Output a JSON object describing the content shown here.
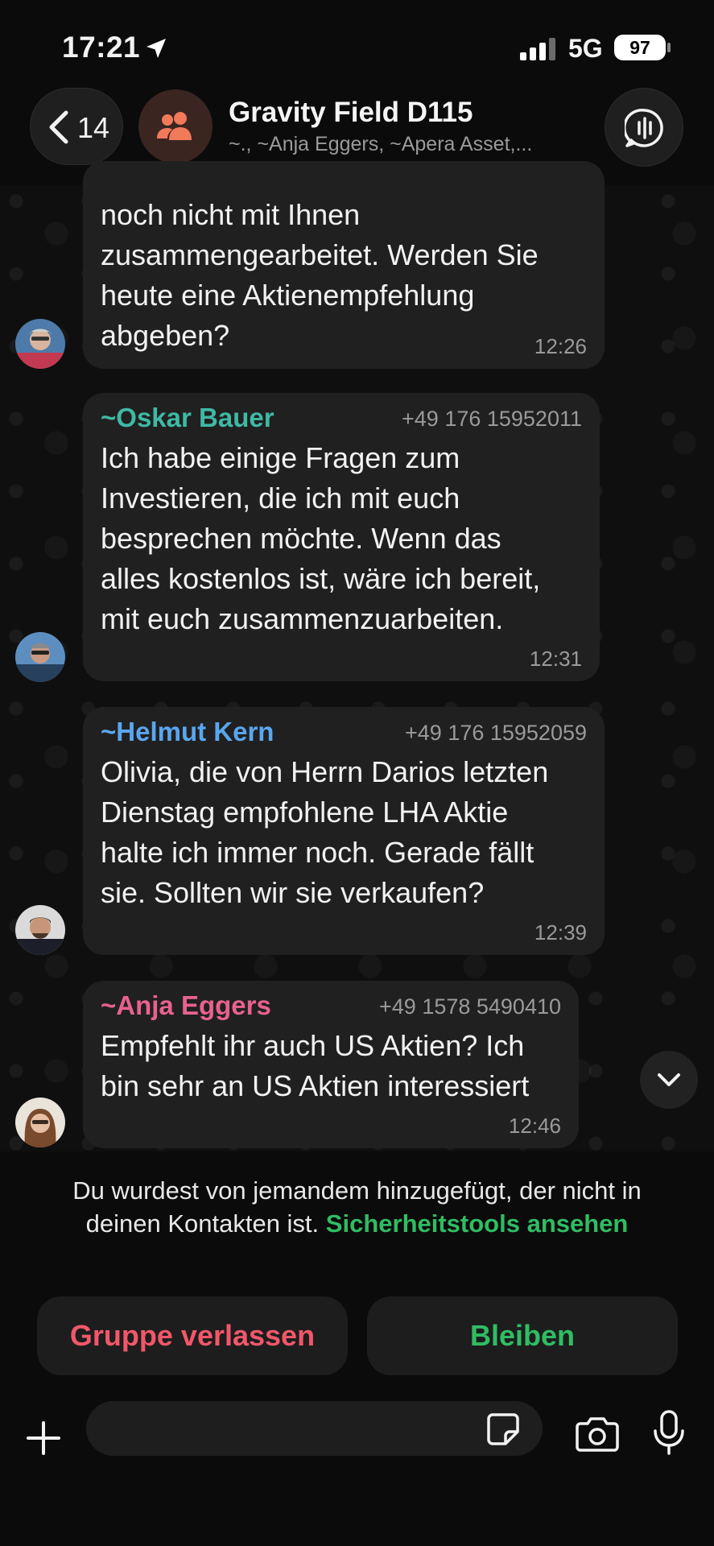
{
  "status_bar": {
    "time": "17:21",
    "network": "5G",
    "battery": "97"
  },
  "header": {
    "back_count": "14",
    "title": "Gravity Field D115",
    "subtitle": "~., ~Anja Eggers, ~Apera Asset,..."
  },
  "messages": [
    {
      "lines": [
        "noch nicht mit Ihnen",
        "zusammengearbeitet. Werden Sie",
        "heute eine Aktienempfehlung",
        "abgeben?"
      ],
      "time": "12:26"
    },
    {
      "sender": "~Oskar Bauer",
      "sender_color": "#3fb9a4",
      "phone": "+49 176 15952011",
      "lines": [
        "Ich habe einige Fragen zum",
        "Investieren, die ich mit euch",
        "besprechen möchte. Wenn das",
        "alles kostenlos ist, wäre ich bereit,",
        "mit euch zusammenzuarbeiten."
      ],
      "time": "12:31"
    },
    {
      "sender": "~Helmut Kern",
      "sender_color": "#5aa6ee",
      "phone": "+49 176 15952059",
      "lines": [
        "Olivia, die von Herrn Darios letzten",
        "Dienstag empfohlene LHA Aktie",
        "halte ich immer noch. Gerade fällt",
        "sie. Sollten wir sie verkaufen?"
      ],
      "time": "12:39"
    },
    {
      "sender": "~Anja Eggers",
      "sender_color": "#e8628e",
      "phone": "+49 1578 5490410",
      "lines": [
        "Empfehlt ihr auch US Aktien? Ich",
        "bin sehr an US Aktien interessiert"
      ],
      "time": "12:46"
    }
  ],
  "notice": {
    "text": "Du wurdest von jemandem hinzugefügt, der nicht in deinen Kontakten ist.",
    "link": "Sicherheitstools ansehen"
  },
  "actions": {
    "leave": "Gruppe verlassen",
    "stay": "Bleiben"
  },
  "composer": {
    "placeholder": ""
  },
  "colors": {
    "accent_green": "#2fbd63",
    "danger_red": "#f1576a",
    "bubble": "#202020"
  },
  "icons": [
    "location-arrow-icon",
    "signal-icon",
    "battery-icon",
    "chevron-left-icon",
    "group-icon",
    "voice-chat-icon",
    "chevron-down-icon",
    "plus-icon",
    "sticker-icon",
    "camera-icon",
    "microphone-icon"
  ]
}
